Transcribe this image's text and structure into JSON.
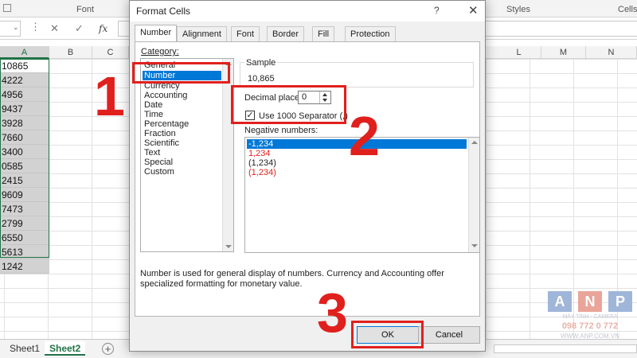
{
  "ribbon": {
    "font_label": "Font",
    "styles_label": "Styles",
    "cells_label": "Cells"
  },
  "formula_bar": {
    "cancel_icon": "✕",
    "enter_icon": "✓",
    "fx_label": "fx"
  },
  "grid": {
    "column_headers": [
      "A",
      "B",
      "C",
      "L",
      "M",
      "N"
    ],
    "selected_column": "A",
    "column_a_values": [
      "10865",
      "4222",
      "4956",
      "9437",
      "3928",
      "7660",
      "3400",
      "0585",
      "2415",
      "9609",
      "7473",
      "2799",
      "6550",
      "5613",
      "1242"
    ]
  },
  "sheets": {
    "tabs": [
      "Sheet1",
      "Sheet2"
    ],
    "active": "Sheet2",
    "add_label": "+"
  },
  "dialog": {
    "title": "Format Cells",
    "help": "?",
    "close": "✕",
    "tabs": [
      "Number",
      "Alignment",
      "Font",
      "Border",
      "Fill",
      "Protection"
    ],
    "active_tab": "Number",
    "category_label": "Category:",
    "categories": [
      "General",
      "Number",
      "Currency",
      "Accounting",
      "Date",
      "Time",
      "Percentage",
      "Fraction",
      "Scientific",
      "Text",
      "Special",
      "Custom"
    ],
    "selected_category": "Number",
    "sample_label": "Sample",
    "sample_value": "10,865",
    "decimal_places_label": "Decimal places:",
    "decimal_places_value": "0",
    "separator_label": "Use 1000 Separator (,)",
    "separator_checked": true,
    "negative_numbers_label": "Negative numbers:",
    "negative_numbers": [
      {
        "text": "-1,234",
        "color": "#ffffff",
        "selected": true
      },
      {
        "text": "1,234",
        "color": "#e0201d",
        "selected": false
      },
      {
        "text": "(1,234)",
        "color": "#222222",
        "selected": false
      },
      {
        "text": "(1,234)",
        "color": "#e0201d",
        "selected": false
      }
    ],
    "description": "Number is used for general display of numbers.  Currency and Accounting offer specialized formatting for monetary value.",
    "ok_label": "OK",
    "cancel_label": "Cancel"
  },
  "annotations": {
    "step1": "1",
    "step2": "2",
    "step3": "3",
    "highlight_color": "#e0201d"
  },
  "watermark": {
    "letters": [
      "A",
      "N",
      "P"
    ],
    "tagline": "MÁY TÍNH - CAMERA",
    "phone": "098 772 0 772",
    "url": "WWW.ANP.COM.VN"
  }
}
